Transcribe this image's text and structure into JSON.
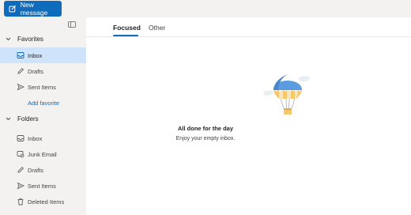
{
  "toolbar": {
    "new_message_label": "New message"
  },
  "sidebar": {
    "favorites_header": "Favorites",
    "favorites": [
      {
        "label": "Inbox",
        "icon": "inbox-icon",
        "active": true
      },
      {
        "label": "Drafts",
        "icon": "drafts-icon"
      },
      {
        "label": "Sent Items",
        "icon": "sent-icon"
      }
    ],
    "add_favorite": "Add favorite",
    "folders_header": "Folders",
    "folders": [
      {
        "label": "Inbox",
        "icon": "inbox-icon"
      },
      {
        "label": "Junk Email",
        "icon": "junk-icon"
      },
      {
        "label": "Drafts",
        "icon": "drafts-icon"
      },
      {
        "label": "Sent Items",
        "icon": "sent-icon"
      },
      {
        "label": "Deleted Items",
        "icon": "trash-icon"
      }
    ]
  },
  "main": {
    "tabs": [
      {
        "label": "Focused",
        "active": true
      },
      {
        "label": "Other"
      }
    ],
    "empty_title": "All done for the day",
    "empty_subtitle": "Enjoy your empty inbox."
  },
  "colors": {
    "accent": "#0f6cbd",
    "selected_bg": "#cfe4fa",
    "sidebar_bg": "#f3f2f1"
  }
}
